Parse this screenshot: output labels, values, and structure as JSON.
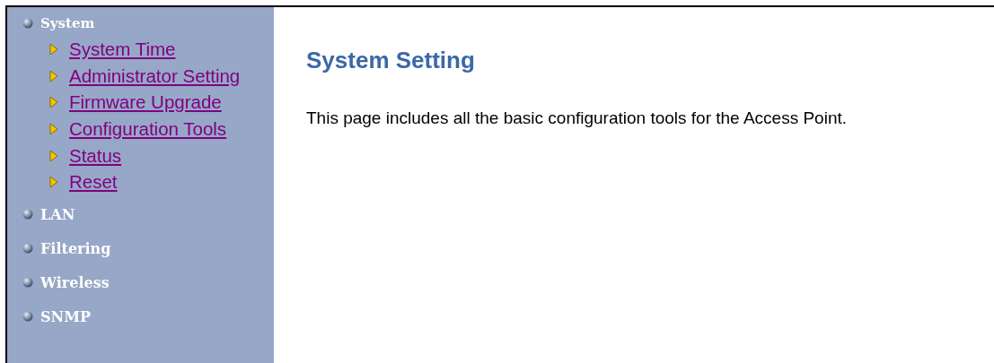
{
  "sidebar": {
    "items": [
      {
        "label": "System",
        "expanded": true,
        "children": [
          {
            "label": "System Time"
          },
          {
            "label": "Administrator Setting"
          },
          {
            "label": "Firmware Upgrade"
          },
          {
            "label": "Configuration Tools"
          },
          {
            "label": "Status"
          },
          {
            "label": "Reset"
          }
        ]
      },
      {
        "label": "LAN",
        "expanded": false
      },
      {
        "label": "Filtering",
        "expanded": false
      },
      {
        "label": "Wireless",
        "expanded": false
      },
      {
        "label": "SNMP",
        "expanded": false
      }
    ]
  },
  "content": {
    "title": "System Setting",
    "description": "This page includes all the basic configuration tools for the Access Point."
  }
}
